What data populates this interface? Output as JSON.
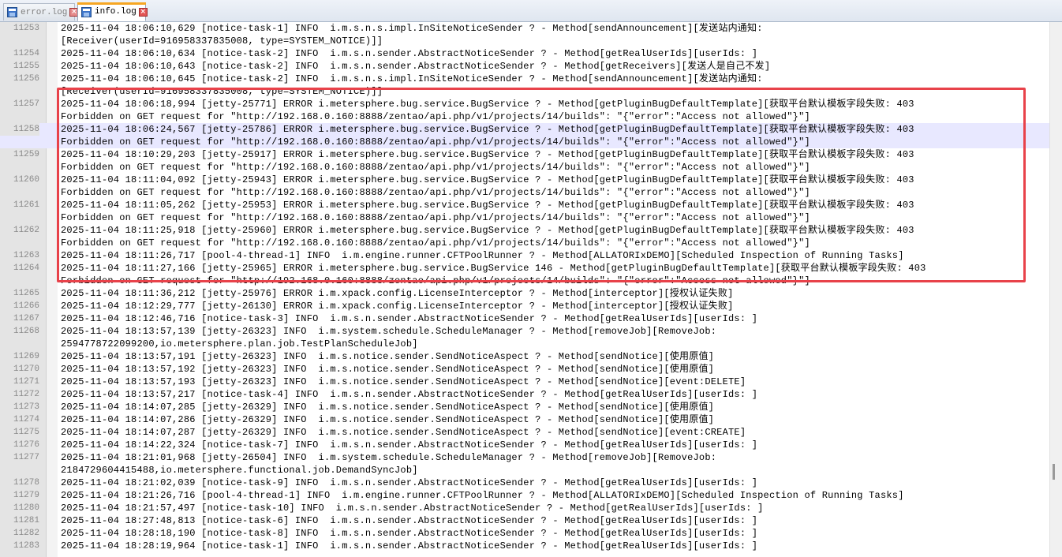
{
  "tabs": [
    {
      "label": "error.log",
      "active": false
    },
    {
      "label": "info.log",
      "active": true
    }
  ],
  "colors": {
    "accent": "#f6a623",
    "annotation": "#e8424a",
    "highlight_row": "#e8e8ff"
  },
  "lines": [
    {
      "num": "11253",
      "text": "2025-11-04 18:06:10,629 [notice-task-1] INFO  i.m.s.n.s.impl.InSiteNoticeSender ? - Method[sendAnnouncement][发送站内通知:"
    },
    {
      "num": "",
      "text": "[Receiver(userId=916958337835008, type=SYSTEM_NOTICE)]]"
    },
    {
      "num": "11254",
      "text": "2025-11-04 18:06:10,634 [notice-task-2] INFO  i.m.s.n.sender.AbstractNoticeSender ? - Method[getRealUserIds][userIds: ]"
    },
    {
      "num": "11255",
      "text": "2025-11-04 18:06:10,643 [notice-task-2] INFO  i.m.s.n.sender.AbstractNoticeSender ? - Method[getReceivers][发送人是自己不发]"
    },
    {
      "num": "11256",
      "text": "2025-11-04 18:06:10,645 [notice-task-2] INFO  i.m.s.n.s.impl.InSiteNoticeSender ? - Method[sendAnnouncement][发送站内通知:"
    },
    {
      "num": "",
      "text": "[Receiver(userId=916958337835008, type=SYSTEM_NOTICE)]]"
    },
    {
      "num": "11257",
      "text": "2025-11-04 18:06:18,994 [jetty-25771] ERROR i.metersphere.bug.service.BugService ? - Method[getPluginBugDefaultTemplate][获取平台默认模板字段失败: 403"
    },
    {
      "num": "",
      "text": "Forbidden on GET request for \"http://192.168.0.160:8888/zentao/api.php/v1/projects/14/builds\": \"{\"error\":\"Access not allowed\"}\"]"
    },
    {
      "num": "11258",
      "text": "2025-11-04 18:06:24,567 [jetty-25786] ERROR i.metersphere.bug.service.BugService ? - Method[getPluginBugDefaultTemplate][获取平台默认模板字段失败: 403",
      "highlight": true
    },
    {
      "num": "",
      "text": "Forbidden on GET request for \"http://192.168.0.160:8888/zentao/api.php/v1/projects/14/builds\": \"{\"error\":\"Access not allowed\"}\"]",
      "highlight": true
    },
    {
      "num": "11259",
      "text": "2025-11-04 18:10:29,203 [jetty-25917] ERROR i.metersphere.bug.service.BugService ? - Method[getPluginBugDefaultTemplate][获取平台默认模板字段失败: 403"
    },
    {
      "num": "",
      "text": "Forbidden on GET request for \"http://192.168.0.160:8888/zentao/api.php/v1/projects/14/builds\": \"{\"error\":\"Access not allowed\"}\"]"
    },
    {
      "num": "11260",
      "text": "2025-11-04 18:11:04,092 [jetty-25943] ERROR i.metersphere.bug.service.BugService ? - Method[getPluginBugDefaultTemplate][获取平台默认模板字段失败: 403"
    },
    {
      "num": "",
      "text": "Forbidden on GET request for \"http://192.168.0.160:8888/zentao/api.php/v1/projects/14/builds\": \"{\"error\":\"Access not allowed\"}\"]"
    },
    {
      "num": "11261",
      "text": "2025-11-04 18:11:05,262 [jetty-25953] ERROR i.metersphere.bug.service.BugService ? - Method[getPluginBugDefaultTemplate][获取平台默认模板字段失败: 403"
    },
    {
      "num": "",
      "text": "Forbidden on GET request for \"http://192.168.0.160:8888/zentao/api.php/v1/projects/14/builds\": \"{\"error\":\"Access not allowed\"}\"]"
    },
    {
      "num": "11262",
      "text": "2025-11-04 18:11:25,918 [jetty-25960] ERROR i.metersphere.bug.service.BugService ? - Method[getPluginBugDefaultTemplate][获取平台默认模板字段失败: 403"
    },
    {
      "num": "",
      "text": "Forbidden on GET request for \"http://192.168.0.160:8888/zentao/api.php/v1/projects/14/builds\": \"{\"error\":\"Access not allowed\"}\"]"
    },
    {
      "num": "11263",
      "text": "2025-11-04 18:11:26,717 [pool-4-thread-1] INFO  i.m.engine.runner.CFTPoolRunner ? - Method[ALLATORIxDEMO][Scheduled Inspection of Running Tasks]"
    },
    {
      "num": "11264",
      "text": "2025-11-04 18:11:27,166 [jetty-25965] ERROR i.metersphere.bug.service.BugService 146 - Method[getPluginBugDefaultTemplate][获取平台默认模板字段失败: 403"
    },
    {
      "num": "",
      "text": "Forbidden on GET request for \"http://192.168.0.160:8888/zentao/api.php/v1/projects/14/builds\": \"{\"error\":\"Access not allowed\"}\"]"
    },
    {
      "num": "11265",
      "text": "2025-11-04 18:11:36,212 [jetty-25976] ERROR i.m.xpack.config.LicenseInterceptor ? - Method[interceptor][授权认证失败]"
    },
    {
      "num": "11266",
      "text": "2025-11-04 18:12:29,777 [jetty-26130] ERROR i.m.xpack.config.LicenseInterceptor ? - Method[interceptor][授权认证失败]"
    },
    {
      "num": "11267",
      "text": "2025-11-04 18:12:46,716 [notice-task-3] INFO  i.m.s.n.sender.AbstractNoticeSender ? - Method[getRealUserIds][userIds: ]"
    },
    {
      "num": "11268",
      "text": "2025-11-04 18:13:57,139 [jetty-26323] INFO  i.m.system.schedule.ScheduleManager ? - Method[removeJob][RemoveJob:"
    },
    {
      "num": "",
      "text": "2594778722099200,io.metersphere.plan.job.TestPlanScheduleJob]"
    },
    {
      "num": "11269",
      "text": "2025-11-04 18:13:57,191 [jetty-26323] INFO  i.m.s.notice.sender.SendNoticeAspect ? - Method[sendNotice][使用原值]"
    },
    {
      "num": "11270",
      "text": "2025-11-04 18:13:57,192 [jetty-26323] INFO  i.m.s.notice.sender.SendNoticeAspect ? - Method[sendNotice][使用原值]"
    },
    {
      "num": "11271",
      "text": "2025-11-04 18:13:57,193 [jetty-26323] INFO  i.m.s.notice.sender.SendNoticeAspect ? - Method[sendNotice][event:DELETE]"
    },
    {
      "num": "11272",
      "text": "2025-11-04 18:13:57,217 [notice-task-4] INFO  i.m.s.n.sender.AbstractNoticeSender ? - Method[getRealUserIds][userIds: ]"
    },
    {
      "num": "11273",
      "text": "2025-11-04 18:14:07,285 [jetty-26329] INFO  i.m.s.notice.sender.SendNoticeAspect ? - Method[sendNotice][使用原值]"
    },
    {
      "num": "11274",
      "text": "2025-11-04 18:14:07,286 [jetty-26329] INFO  i.m.s.notice.sender.SendNoticeAspect ? - Method[sendNotice][使用原值]"
    },
    {
      "num": "11275",
      "text": "2025-11-04 18:14:07,287 [jetty-26329] INFO  i.m.s.notice.sender.SendNoticeAspect ? - Method[sendNotice][event:CREATE]"
    },
    {
      "num": "11276",
      "text": "2025-11-04 18:14:22,324 [notice-task-7] INFO  i.m.s.n.sender.AbstractNoticeSender ? - Method[getRealUserIds][userIds: ]"
    },
    {
      "num": "11277",
      "text": "2025-11-04 18:21:01,968 [jetty-26504] INFO  i.m.system.schedule.ScheduleManager ? - Method[removeJob][RemoveJob:"
    },
    {
      "num": "",
      "text": "2184729604415488,io.metersphere.functional.job.DemandSyncJob]"
    },
    {
      "num": "11278",
      "text": "2025-11-04 18:21:02,039 [notice-task-9] INFO  i.m.s.n.sender.AbstractNoticeSender ? - Method[getRealUserIds][userIds: ]"
    },
    {
      "num": "11279",
      "text": "2025-11-04 18:21:26,716 [pool-4-thread-1] INFO  i.m.engine.runner.CFTPoolRunner ? - Method[ALLATORIxDEMO][Scheduled Inspection of Running Tasks]"
    },
    {
      "num": "11280",
      "text": "2025-11-04 18:21:57,497 [notice-task-10] INFO  i.m.s.n.sender.AbstractNoticeSender ? - Method[getRealUserIds][userIds: ]"
    },
    {
      "num": "11281",
      "text": "2025-11-04 18:27:48,813 [notice-task-6] INFO  i.m.s.n.sender.AbstractNoticeSender ? - Method[getRealUserIds][userIds: ]"
    },
    {
      "num": "11282",
      "text": "2025-11-04 18:28:18,190 [notice-task-8] INFO  i.m.s.n.sender.AbstractNoticeSender ? - Method[getRealUserIds][userIds: ]"
    },
    {
      "num": "11283",
      "text": "2025-11-04 18:28:19,964 [notice-task-1] INFO  i.m.s.n.sender.AbstractNoticeSender ? - Method[getRealUserIds][userIds: ]"
    }
  ]
}
